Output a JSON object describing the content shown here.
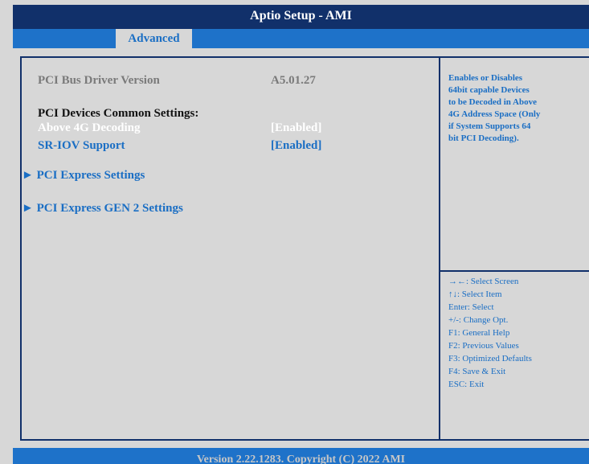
{
  "header": {
    "title": "Aptio Setup - AMI"
  },
  "tabs": [
    {
      "label": "Advanced",
      "active": true
    }
  ],
  "main": {
    "driver_version_label": "PCI Bus Driver Version",
    "driver_version_value": "A5.01.27",
    "section_title": "PCI Devices Common Settings:",
    "settings": [
      {
        "label": "Above 4G Decoding",
        "value": "[Enabled]"
      },
      {
        "label": "SR-IOV Support",
        "value": "[Enabled]"
      }
    ],
    "submenus": [
      {
        "arrow": "►",
        "label": "PCI Express Settings"
      },
      {
        "arrow": "►",
        "label": "PCI Express GEN 2 Settings"
      }
    ]
  },
  "help": {
    "description": "Enables or Disables\n64bit capable Devices\nto be Decoded in Above\n4G Address Space (Only\nif System Supports 64\nbit PCI Decoding).",
    "keys": [
      "→←: Select Screen",
      "↑↓: Select Item",
      "Enter: Select",
      "+/-: Change Opt.",
      "F1: General Help",
      "F2: Previous Values",
      "F3: Optimized Defaults",
      "F4: Save & Exit",
      "ESC: Exit"
    ]
  },
  "footer": {
    "text": "Version 2.22.1283. Copyright (C) 2022 AMI"
  },
  "colors": {
    "title_bar": "#11306a",
    "tab_bar": "#1e72c9",
    "panel": "#d7d7d7",
    "accent_text": "#1a6ec4",
    "highlight_text": "#ffffff"
  }
}
